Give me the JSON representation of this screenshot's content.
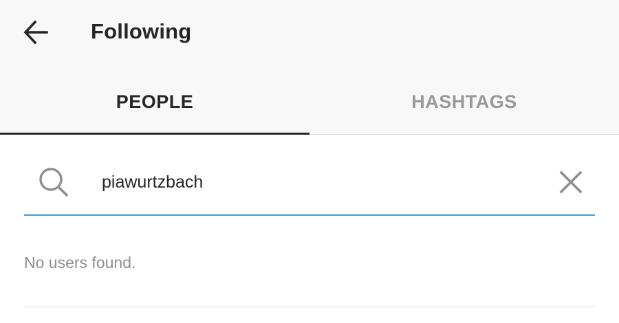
{
  "header": {
    "back_icon": "arrow-left-icon",
    "title": "Following"
  },
  "tabs": [
    {
      "label": "PEOPLE",
      "active": true
    },
    {
      "label": "HASHTAGS",
      "active": false
    }
  ],
  "search": {
    "icon": "search-icon",
    "value": "piawurtzbach",
    "clear_icon": "close-icon",
    "underline_color": "#4a9ad1"
  },
  "results": {
    "empty_message": "No users found."
  }
}
